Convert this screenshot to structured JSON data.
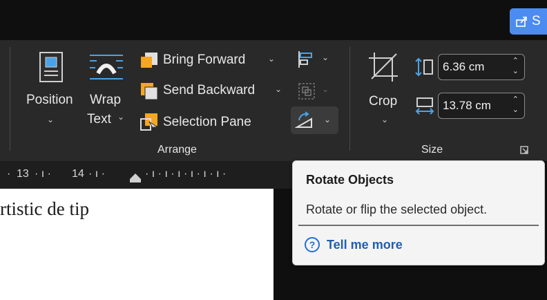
{
  "share": {
    "label": "S"
  },
  "arrange": {
    "position_label": "Position",
    "wrap_label_1": "Wrap",
    "wrap_label_2": "Text",
    "bring_forward": "Bring Forward",
    "send_backward": "Send Backward",
    "selection_pane": "Selection Pane",
    "group_label": "Arrange"
  },
  "size": {
    "crop_label": "Crop",
    "height_value": "6.36 cm",
    "width_value": "13.78 cm",
    "group_label": "Size"
  },
  "ruler": {
    "tick_13": "13",
    "tick_14": "14"
  },
  "document": {
    "text": "rtistic de tip"
  },
  "tooltip": {
    "title": "Rotate Objects",
    "description": "Rotate or flip the selected object.",
    "link": "Tell me more"
  },
  "colors": {
    "ribbon_bg": "#292929",
    "share_blue": "#4c8cf0",
    "icon_orange": "#f5a623",
    "icon_blue": "#4aa3e8"
  }
}
